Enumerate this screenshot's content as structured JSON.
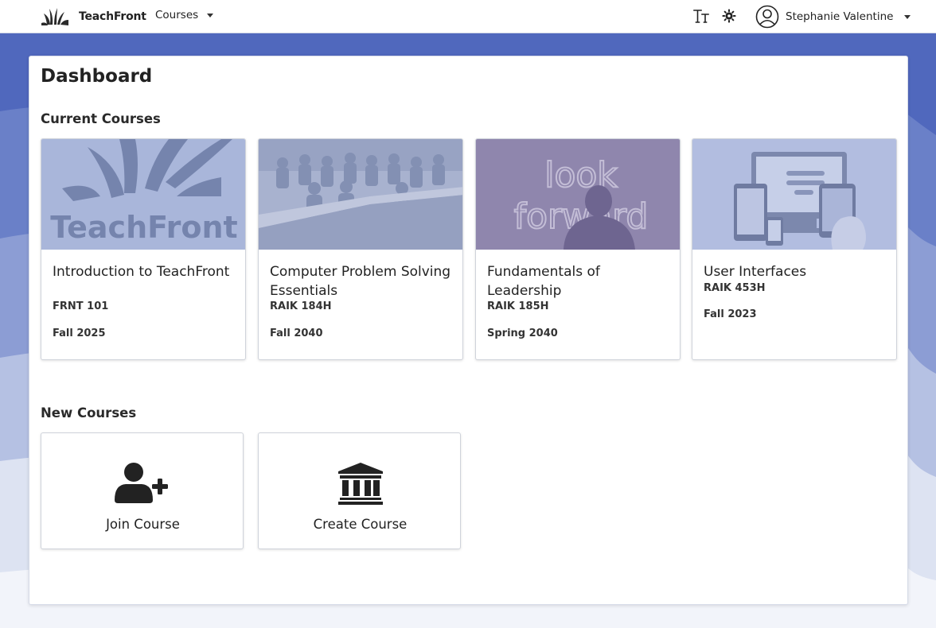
{
  "app": {
    "name": "TeachFront"
  },
  "nav": {
    "courses_label": "Courses",
    "text_size_icon": "text-size-icon",
    "theme_icon": "gear-icon",
    "user": {
      "name": "Stephanie Valentine",
      "icon": "user-circle-icon"
    }
  },
  "dashboard": {
    "title": "Dashboard",
    "current_section": "Current Courses",
    "new_section": "New Courses",
    "courses": [
      {
        "title": "Introduction to TeachFront",
        "code": "FRNT 101",
        "term": "Fall 2025"
      },
      {
        "title": "Computer Problem Solving Essentials",
        "code": "RAIK 184H",
        "term": "Fall 2040"
      },
      {
        "title": "Fundamentals of Leadership",
        "code": "RAIK 185H",
        "term": "Spring 2040"
      },
      {
        "title": "User Interfaces",
        "code": "RAIK 453H",
        "term": "Fall 2023"
      }
    ],
    "images": {
      "logo_text": "TeachFront",
      "board_line1": "look",
      "board_line2": "forward"
    },
    "actions": [
      {
        "label": "Join Course",
        "icon": "user-plus-icon"
      },
      {
        "label": "Create Course",
        "icon": "institution-icon"
      }
    ]
  },
  "colors": {
    "brand_blue": "#4f6cc0",
    "card_tint": "#a9b6da",
    "text": "#222222"
  }
}
